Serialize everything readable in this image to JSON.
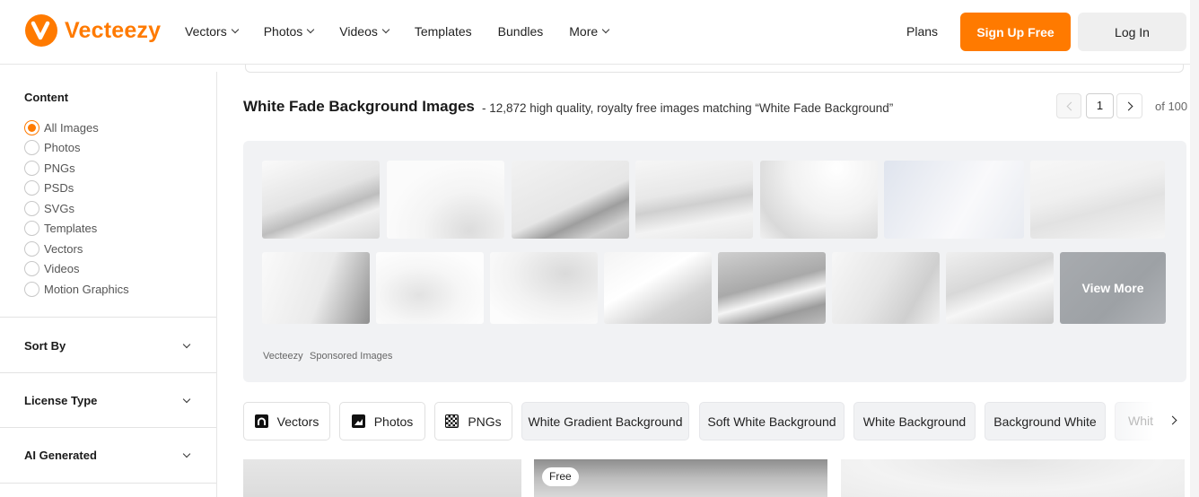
{
  "header": {
    "logo_text": "Vecteezy",
    "nav": [
      "Vectors",
      "Photos",
      "Videos",
      "Templates",
      "Bundles",
      "More"
    ],
    "plans": "Plans",
    "signup": "Sign Up Free",
    "login": "Log In",
    "accent": "#ff7a00"
  },
  "sidebar": {
    "content_title": "Content",
    "content_options": [
      "All Images",
      "Photos",
      "PNGs",
      "PSDs",
      "SVGs",
      "Templates",
      "Vectors",
      "Videos",
      "Motion Graphics"
    ],
    "selected": "All Images",
    "sections": [
      "Sort By",
      "License Type",
      "AI Generated"
    ]
  },
  "main": {
    "title": "White Fade Background Images",
    "subtitle": "- 12,872 high quality, royalty free images matching “White Fade Background”",
    "pager": {
      "current": "1",
      "of": "of 100"
    }
  },
  "sponsored": {
    "view_more": "View More",
    "footer_brand": "Vecteezy",
    "footer_label": "Sponsored Images"
  },
  "chips": {
    "type_chips": [
      {
        "label": "Vectors",
        "icon": "vector-icon"
      },
      {
        "label": "Photos",
        "icon": "photo-icon"
      },
      {
        "label": "PNGs",
        "icon": "png-icon"
      }
    ],
    "related": [
      "White Gradient Background",
      "Soft White Background",
      "White Background",
      "Background White"
    ],
    "truncated": "Whit"
  },
  "results": {
    "badge": "Free"
  }
}
